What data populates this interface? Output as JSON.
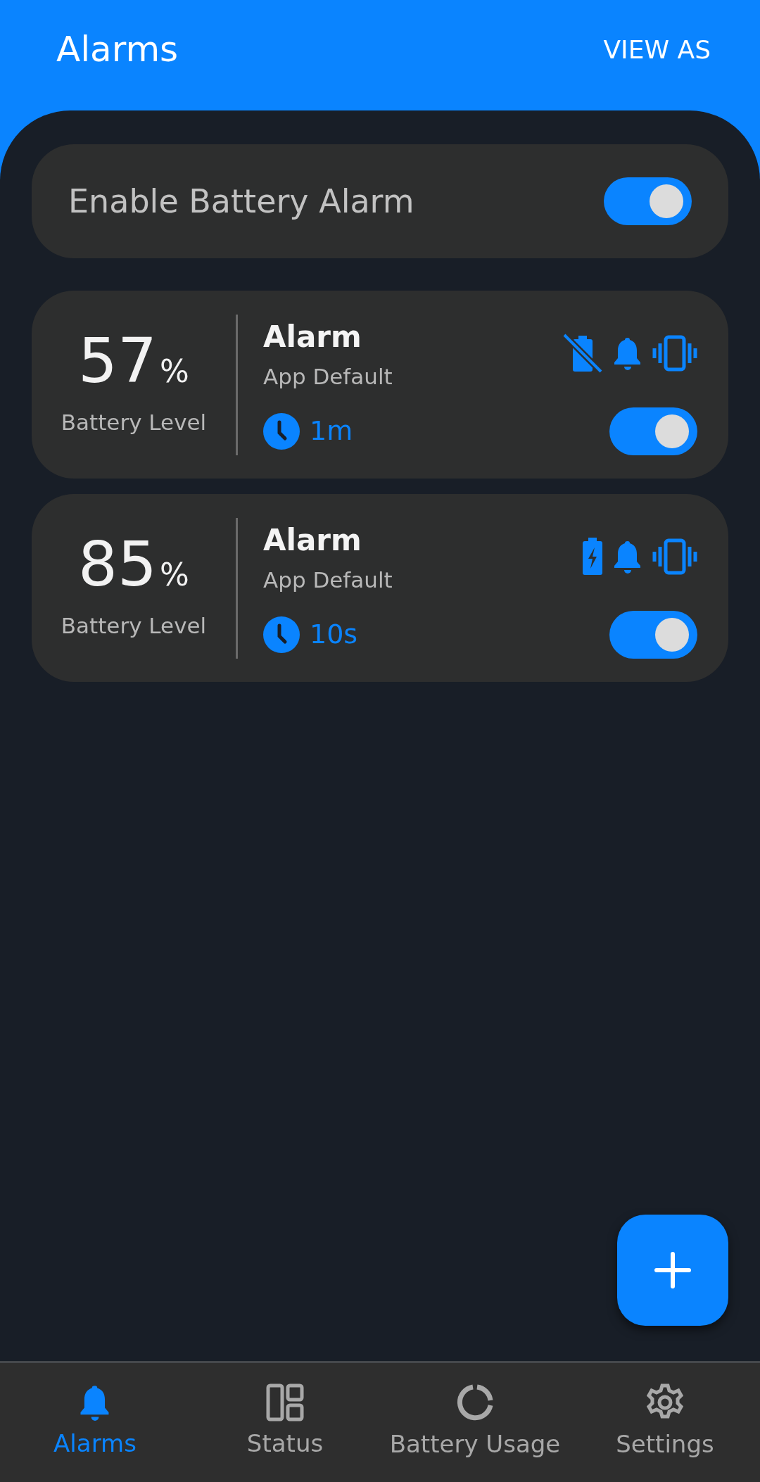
{
  "header": {
    "title": "Alarms",
    "action": "VIEW AS"
  },
  "enable_alarm": {
    "label": "Enable Battery Alarm",
    "on": true
  },
  "alarms": [
    {
      "value": "57",
      "unit": "%",
      "caption": "Battery Level",
      "title": "Alarm",
      "sound": "App Default",
      "interval": "1m",
      "charging": false,
      "on": true
    },
    {
      "value": "85",
      "unit": "%",
      "caption": "Battery Level",
      "title": "Alarm",
      "sound": "App Default",
      "interval": "10s",
      "charging": true,
      "on": true
    }
  ],
  "nav": [
    {
      "kind": "alarms",
      "label": "Alarms",
      "selected": true
    },
    {
      "kind": "status",
      "label": "Status",
      "selected": false
    },
    {
      "kind": "usage",
      "label": "Battery Usage",
      "selected": false
    },
    {
      "kind": "settings",
      "label": "Settings",
      "selected": false
    }
  ]
}
